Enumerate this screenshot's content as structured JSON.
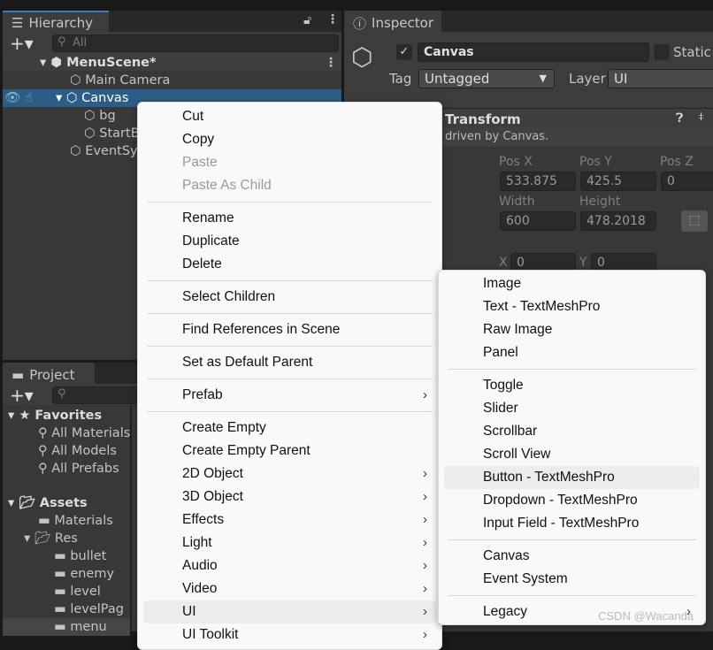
{
  "hierarchy": {
    "tab": "Hierarchy",
    "search_placeholder": "All",
    "scene": "MenuScene*",
    "items": [
      "Main Camera",
      "Canvas",
      "bg",
      "StartB",
      "EventSy"
    ]
  },
  "project": {
    "tab": "Project",
    "favorites": "Favorites",
    "fav_items": [
      "All Materials",
      "All Models",
      "All Prefabs"
    ],
    "assets": "Assets",
    "asset_items": [
      "Materials",
      "Res"
    ],
    "res_items": [
      "bullet",
      "enemy",
      "level",
      "levelPag",
      "menu"
    ]
  },
  "inspector": {
    "tab": "Inspector",
    "object_name": "Canvas",
    "active": true,
    "static_label": "Static",
    "tag_label": "Tag",
    "tag_value": "Untagged",
    "layer_label": "Layer",
    "layer_value": "UI",
    "component": "Transform",
    "info": "driven by Canvas.",
    "pos_x_label": "Pos X",
    "pos_y_label": "Pos Y",
    "pos_z_label": "Pos Z",
    "pos_x": "533.875",
    "pos_y": "425.5",
    "pos_z": "0",
    "width_label": "Width",
    "height_label": "Height",
    "width": "600",
    "height": "478.2018",
    "x_label": "X",
    "y_label": "Y",
    "x": "0",
    "y": "0"
  },
  "context_menu": {
    "groups": [
      [
        "Cut",
        "Copy",
        "Paste",
        "Paste As Child"
      ],
      [
        "Rename",
        "Duplicate",
        "Delete"
      ],
      [
        "Select Children"
      ],
      [
        "Find References in Scene"
      ],
      [
        "Set as Default Parent"
      ],
      [
        "Prefab"
      ],
      [
        "Create Empty",
        "Create Empty Parent",
        "2D Object",
        "3D Object",
        "Effects",
        "Light",
        "Audio",
        "Video",
        "UI",
        "UI Toolkit"
      ]
    ],
    "disabled": [
      "Paste",
      "Paste As Child"
    ],
    "highlighted": "UI"
  },
  "ui_submenu": {
    "groups": [
      [
        "Image",
        "Text - TextMeshPro",
        "Raw Image",
        "Panel"
      ],
      [
        "Toggle",
        "Slider",
        "Scrollbar",
        "Scroll View",
        "Button - TextMeshPro",
        "Dropdown - TextMeshPro",
        "Input Field - TextMeshPro"
      ],
      [
        "Canvas",
        "Event System"
      ],
      [
        "Legacy"
      ]
    ],
    "highlighted": "Button - TextMeshPro"
  },
  "watermark": "CSDN @Wacanda",
  "colors": {
    "selection": "#2c5d87",
    "menu_bg": "#f9f9f9",
    "accent": "#3a79bb"
  }
}
